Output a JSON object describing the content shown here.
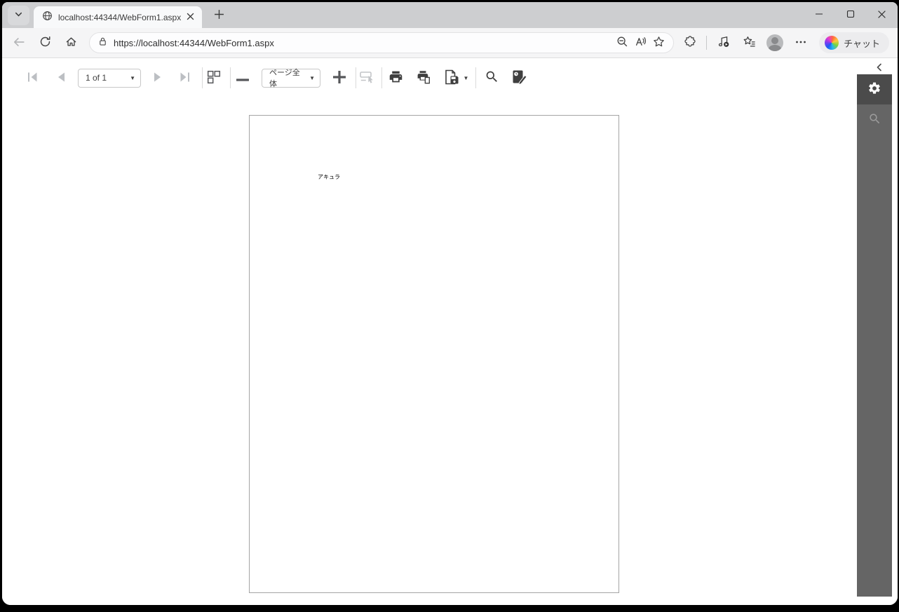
{
  "browser": {
    "tab_title": "localhost:44344/WebForm1.aspx",
    "url": "https://localhost:44344/WebForm1.aspx",
    "copilot_label": "チャット"
  },
  "viewer": {
    "page_indicator": "1 of 1",
    "zoom_mode_selected": "ページ全体",
    "document_text": "アキュラ"
  },
  "glyphs": {
    "dropdown_caret": "▼",
    "more_dots": "•••"
  },
  "icons": [
    "chevron-down-icon",
    "globe-icon",
    "close-icon",
    "plus-icon",
    "minimize-icon",
    "maximize-icon",
    "back-icon",
    "refresh-icon",
    "home-icon",
    "lock-icon",
    "zoom-out-icon",
    "read-aloud-icon",
    "star-icon",
    "extensions-icon",
    "media-icon",
    "collections-icon",
    "avatar",
    "more-icon",
    "copilot-logo",
    "first-page-icon",
    "prev-page-icon",
    "next-page-icon",
    "last-page-icon",
    "multipage-view-icon",
    "zoom-minus-icon",
    "zoom-plus-icon",
    "select-tool-icon",
    "print-icon",
    "print-page-icon",
    "export-icon",
    "search-icon",
    "annotate-icon",
    "collapse-chevron-icon",
    "gear-icon",
    "sidebar-search-icon"
  ],
  "colors": {
    "tabstrip_bg": "#cdced0",
    "navbar_bg": "#f5f5f6",
    "toolbar_icon": "#3f3f3f",
    "disabled_icon": "#bcbfc3",
    "sidebar_bg": "#656565",
    "sidebar_active_bg": "#4b4b4b",
    "page_border": "#a4a4a4"
  }
}
